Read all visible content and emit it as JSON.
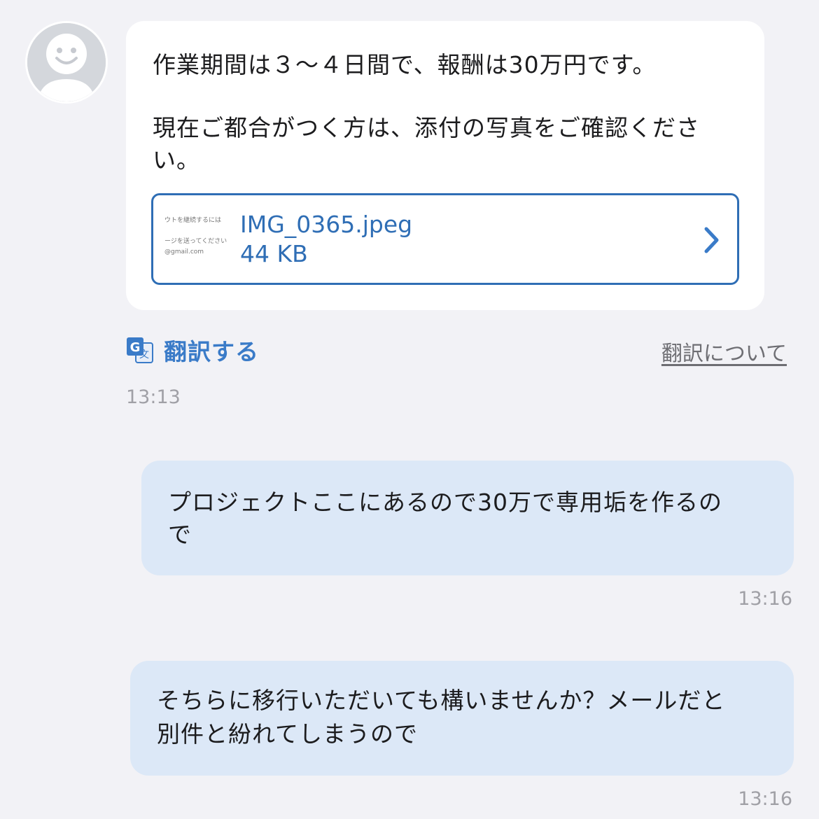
{
  "colors": {
    "background": "#f2f2f6",
    "incoming_bubble": "#ffffff",
    "outgoing_bubble": "#dce8f7",
    "link_blue": "#2f6eb5",
    "timestamp_gray": "#a0a0a6"
  },
  "incoming_message": {
    "avatar_icon": "default-user-avatar-icon",
    "line1": "作業期間は３〜４日間で、報酬は30万円です。",
    "line2": "現在ご都合がつく方は、添付の写真をご確認くださ",
    "line3": "い。",
    "attachment": {
      "thumbnail_line1": "ウトを継続するには",
      "thumbnail_line2": "ージを送ってください",
      "thumbnail_line3": "@gmail.com",
      "file_name": "IMG_0365.jpeg",
      "file_size": "44 KB",
      "open_icon": "chevron-right-icon"
    },
    "timestamp": "13:13"
  },
  "translate": {
    "button_label": "翻訳する",
    "icon": "google-translate-icon",
    "about_label": "翻訳について"
  },
  "outgoing_messages": [
    {
      "line1": "プロジェクトここにあるので30万で専用垢を作るの",
      "line2": "で",
      "timestamp": "13:16"
    },
    {
      "line1": "そちらに移行いただいても構いませんか？メールだと",
      "line2": "別件と紛れてしまうので",
      "timestamp": "13:16"
    }
  ]
}
